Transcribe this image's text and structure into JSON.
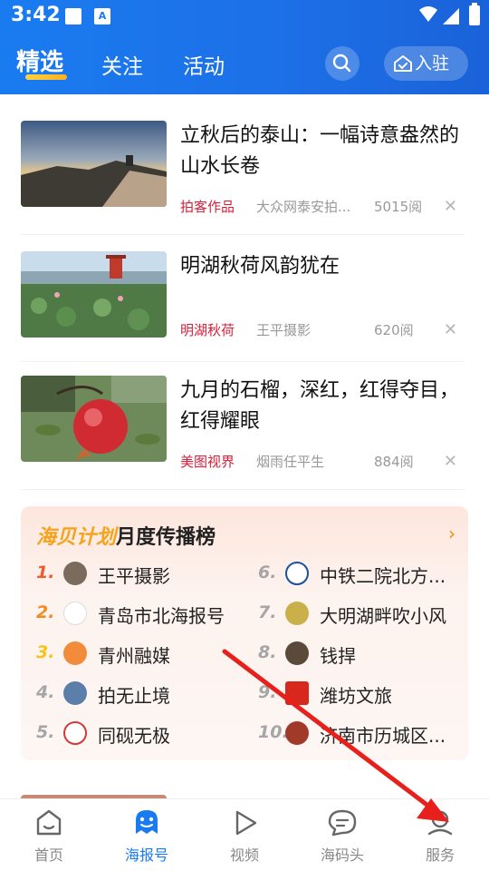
{
  "status": {
    "time": "3:42",
    "notif_icon": "A"
  },
  "header": {
    "tabs": [
      "精选",
      "关注",
      "活动"
    ],
    "join_label": "入驻"
  },
  "articles": [
    {
      "title": "立秋后的泰山：一幅诗意盎然的山水长卷",
      "tag": "拍客作品",
      "source": "大众网泰安拍...",
      "reads": "5015阅"
    },
    {
      "title": "明湖秋荷风韵犹在",
      "tag": "明湖秋荷",
      "source": "王平摄影",
      "reads": "620阅"
    },
    {
      "title": "九月的石榴，深红，红得夺目，红得耀眼",
      "tag": "美图视界",
      "source": "烟雨任平生",
      "reads": "884阅"
    }
  ],
  "ranking": {
    "title_highlight": "海贝计划",
    "title_rest": "月度传播榜",
    "more": "›",
    "items": [
      {
        "rank": "1.",
        "name": "王平摄影"
      },
      {
        "rank": "2.",
        "name": "青岛市北海报号"
      },
      {
        "rank": "3.",
        "name": "青州融媒"
      },
      {
        "rank": "4.",
        "name": "拍无止境"
      },
      {
        "rank": "5.",
        "name": "同砚无极"
      },
      {
        "rank": "6.",
        "name": "中铁二院北方..."
      },
      {
        "rank": "7.",
        "name": "大明湖畔吹小风"
      },
      {
        "rank": "8.",
        "name": "钱捍"
      },
      {
        "rank": "9.",
        "name": "潍坊文旅"
      },
      {
        "rank": "10.",
        "name": "济南市历城区..."
      }
    ]
  },
  "bottom_nav": [
    {
      "label": "首页",
      "icon": "home-icon"
    },
    {
      "label": "海报号",
      "icon": "haibao-icon"
    },
    {
      "label": "视频",
      "icon": "play-icon"
    },
    {
      "label": "海码头",
      "icon": "chat-icon"
    },
    {
      "label": "服务",
      "icon": "user-icon"
    }
  ],
  "colors": {
    "brand_blue": "#1a7bf0",
    "tag_red": "#d81e3a",
    "rank_orange": "#f7a21b",
    "arrow_red": "#e8201c"
  }
}
